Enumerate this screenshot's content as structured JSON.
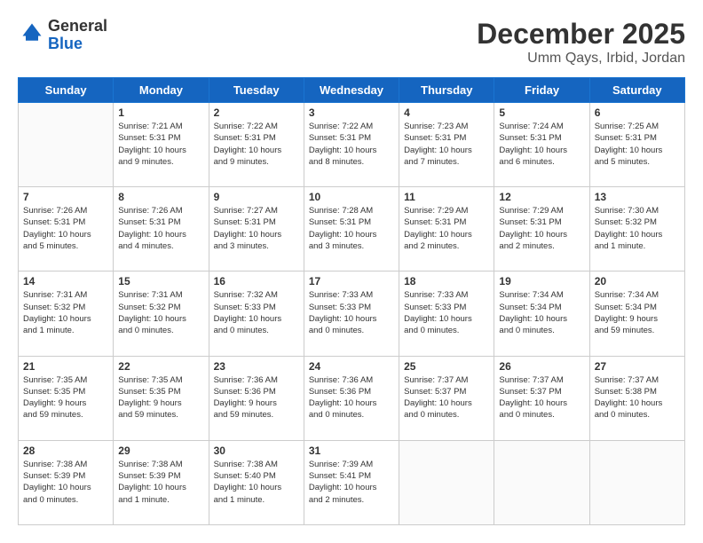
{
  "logo": {
    "line1": "General",
    "line2": "Blue"
  },
  "header": {
    "month": "December 2025",
    "location": "Umm Qays, Irbid, Jordan"
  },
  "weekdays": [
    "Sunday",
    "Monday",
    "Tuesday",
    "Wednesday",
    "Thursday",
    "Friday",
    "Saturday"
  ],
  "weeks": [
    [
      {
        "day": "",
        "info": ""
      },
      {
        "day": "1",
        "info": "Sunrise: 7:21 AM\nSunset: 5:31 PM\nDaylight: 10 hours\nand 9 minutes."
      },
      {
        "day": "2",
        "info": "Sunrise: 7:22 AM\nSunset: 5:31 PM\nDaylight: 10 hours\nand 9 minutes."
      },
      {
        "day": "3",
        "info": "Sunrise: 7:22 AM\nSunset: 5:31 PM\nDaylight: 10 hours\nand 8 minutes."
      },
      {
        "day": "4",
        "info": "Sunrise: 7:23 AM\nSunset: 5:31 PM\nDaylight: 10 hours\nand 7 minutes."
      },
      {
        "day": "5",
        "info": "Sunrise: 7:24 AM\nSunset: 5:31 PM\nDaylight: 10 hours\nand 6 minutes."
      },
      {
        "day": "6",
        "info": "Sunrise: 7:25 AM\nSunset: 5:31 PM\nDaylight: 10 hours\nand 5 minutes."
      }
    ],
    [
      {
        "day": "7",
        "info": "Sunrise: 7:26 AM\nSunset: 5:31 PM\nDaylight: 10 hours\nand 5 minutes."
      },
      {
        "day": "8",
        "info": "Sunrise: 7:26 AM\nSunset: 5:31 PM\nDaylight: 10 hours\nand 4 minutes."
      },
      {
        "day": "9",
        "info": "Sunrise: 7:27 AM\nSunset: 5:31 PM\nDaylight: 10 hours\nand 3 minutes."
      },
      {
        "day": "10",
        "info": "Sunrise: 7:28 AM\nSunset: 5:31 PM\nDaylight: 10 hours\nand 3 minutes."
      },
      {
        "day": "11",
        "info": "Sunrise: 7:29 AM\nSunset: 5:31 PM\nDaylight: 10 hours\nand 2 minutes."
      },
      {
        "day": "12",
        "info": "Sunrise: 7:29 AM\nSunset: 5:31 PM\nDaylight: 10 hours\nand 2 minutes."
      },
      {
        "day": "13",
        "info": "Sunrise: 7:30 AM\nSunset: 5:32 PM\nDaylight: 10 hours\nand 1 minute."
      }
    ],
    [
      {
        "day": "14",
        "info": "Sunrise: 7:31 AM\nSunset: 5:32 PM\nDaylight: 10 hours\nand 1 minute."
      },
      {
        "day": "15",
        "info": "Sunrise: 7:31 AM\nSunset: 5:32 PM\nDaylight: 10 hours\nand 0 minutes."
      },
      {
        "day": "16",
        "info": "Sunrise: 7:32 AM\nSunset: 5:33 PM\nDaylight: 10 hours\nand 0 minutes."
      },
      {
        "day": "17",
        "info": "Sunrise: 7:33 AM\nSunset: 5:33 PM\nDaylight: 10 hours\nand 0 minutes."
      },
      {
        "day": "18",
        "info": "Sunrise: 7:33 AM\nSunset: 5:33 PM\nDaylight: 10 hours\nand 0 minutes."
      },
      {
        "day": "19",
        "info": "Sunrise: 7:34 AM\nSunset: 5:34 PM\nDaylight: 10 hours\nand 0 minutes."
      },
      {
        "day": "20",
        "info": "Sunrise: 7:34 AM\nSunset: 5:34 PM\nDaylight: 9 hours\nand 59 minutes."
      }
    ],
    [
      {
        "day": "21",
        "info": "Sunrise: 7:35 AM\nSunset: 5:35 PM\nDaylight: 9 hours\nand 59 minutes."
      },
      {
        "day": "22",
        "info": "Sunrise: 7:35 AM\nSunset: 5:35 PM\nDaylight: 9 hours\nand 59 minutes."
      },
      {
        "day": "23",
        "info": "Sunrise: 7:36 AM\nSunset: 5:36 PM\nDaylight: 9 hours\nand 59 minutes."
      },
      {
        "day": "24",
        "info": "Sunrise: 7:36 AM\nSunset: 5:36 PM\nDaylight: 10 hours\nand 0 minutes."
      },
      {
        "day": "25",
        "info": "Sunrise: 7:37 AM\nSunset: 5:37 PM\nDaylight: 10 hours\nand 0 minutes."
      },
      {
        "day": "26",
        "info": "Sunrise: 7:37 AM\nSunset: 5:37 PM\nDaylight: 10 hours\nand 0 minutes."
      },
      {
        "day": "27",
        "info": "Sunrise: 7:37 AM\nSunset: 5:38 PM\nDaylight: 10 hours\nand 0 minutes."
      }
    ],
    [
      {
        "day": "28",
        "info": "Sunrise: 7:38 AM\nSunset: 5:39 PM\nDaylight: 10 hours\nand 0 minutes."
      },
      {
        "day": "29",
        "info": "Sunrise: 7:38 AM\nSunset: 5:39 PM\nDaylight: 10 hours\nand 1 minute."
      },
      {
        "day": "30",
        "info": "Sunrise: 7:38 AM\nSunset: 5:40 PM\nDaylight: 10 hours\nand 1 minute."
      },
      {
        "day": "31",
        "info": "Sunrise: 7:39 AM\nSunset: 5:41 PM\nDaylight: 10 hours\nand 2 minutes."
      },
      {
        "day": "",
        "info": ""
      },
      {
        "day": "",
        "info": ""
      },
      {
        "day": "",
        "info": ""
      }
    ]
  ]
}
